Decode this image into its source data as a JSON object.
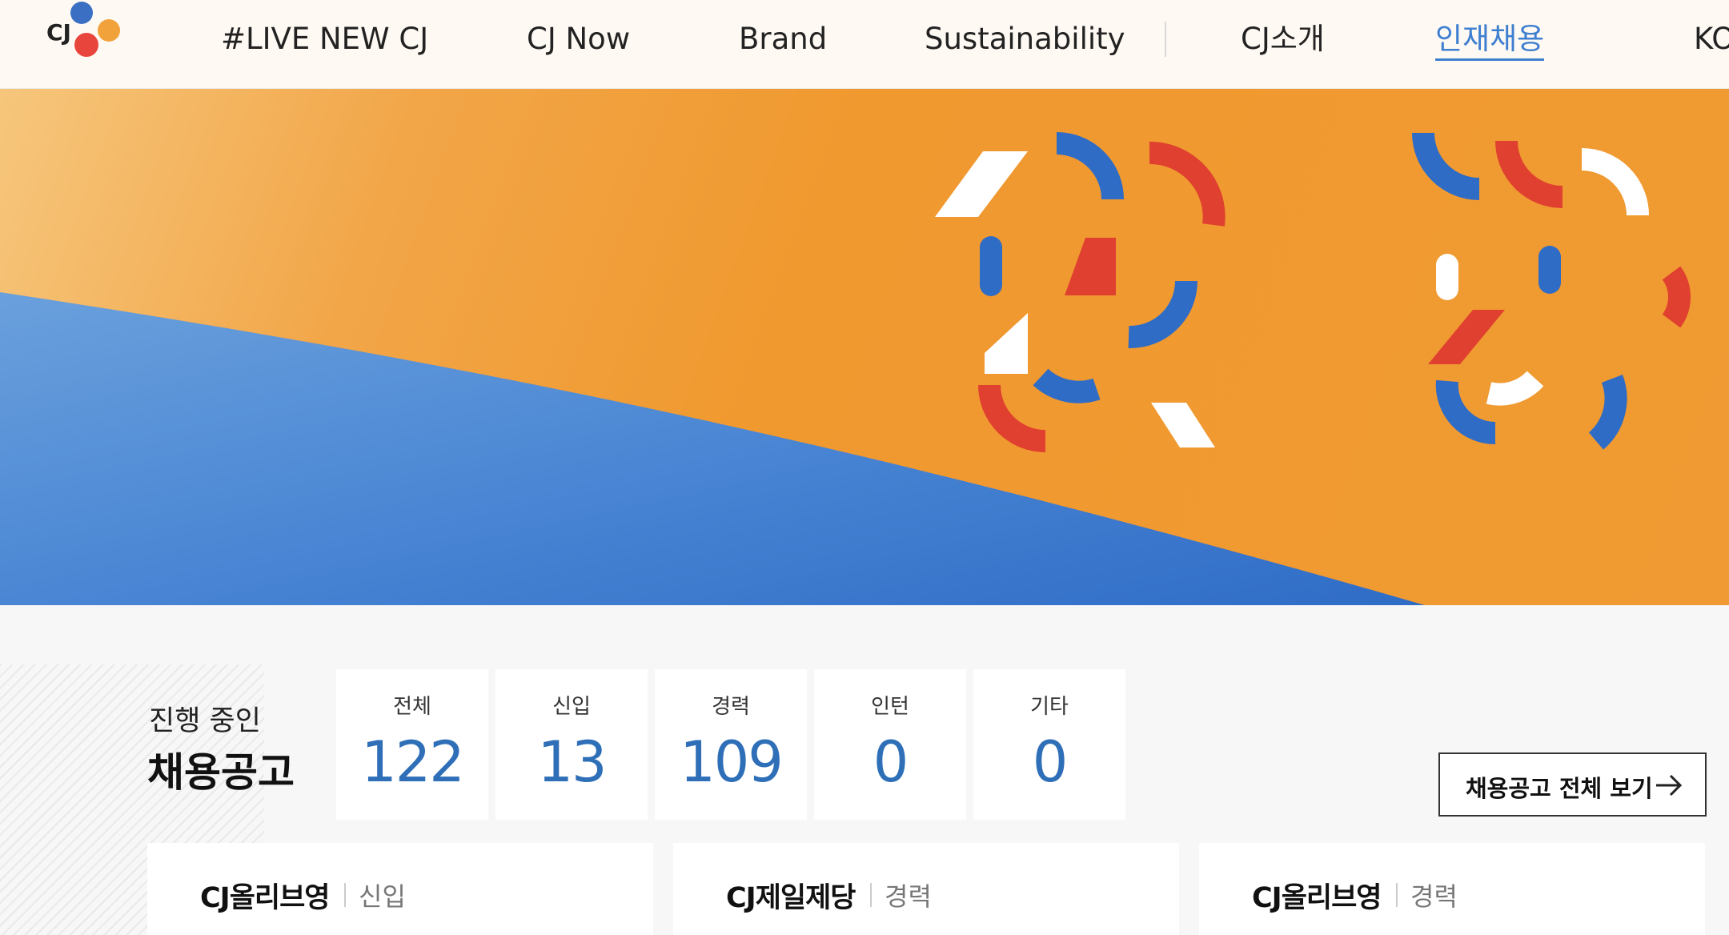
{
  "brand": {
    "logo_text": "CJ",
    "logo_colors": [
      "#3a6fc4",
      "#e8453c",
      "#f2a23a"
    ]
  },
  "nav": {
    "items": [
      {
        "label": "#LIVE NEW CJ",
        "active": false
      },
      {
        "label": "CJ Now",
        "active": false
      },
      {
        "label": "Brand",
        "active": false
      },
      {
        "label": "Sustainability",
        "active": false
      },
      {
        "label": "CJ소개",
        "active": false
      },
      {
        "label": "인재채용",
        "active": true
      }
    ],
    "language": "KO"
  },
  "hero": {
    "colors": {
      "orange": "#f09a33",
      "blue": "#3b78cf",
      "red": "#e0402f",
      "white": "#ffffff"
    }
  },
  "recruit": {
    "subtitle": "진행 중인",
    "title": "채용공고",
    "stats": [
      {
        "label": "전체",
        "value": "122"
      },
      {
        "label": "신입",
        "value": "13"
      },
      {
        "label": "경력",
        "value": "109"
      },
      {
        "label": "인턴",
        "value": "0"
      },
      {
        "label": "기타",
        "value": "0"
      }
    ],
    "view_all_label": "채용공고 전체 보기",
    "view_all_icon": "arrow-right-icon",
    "accent_color": "#2f6fb8"
  },
  "postings": [
    {
      "company": "CJ올리브영",
      "type": "신입"
    },
    {
      "company": "CJ제일제당",
      "type": "경력"
    },
    {
      "company": "CJ올리브영",
      "type": "경력"
    }
  ]
}
